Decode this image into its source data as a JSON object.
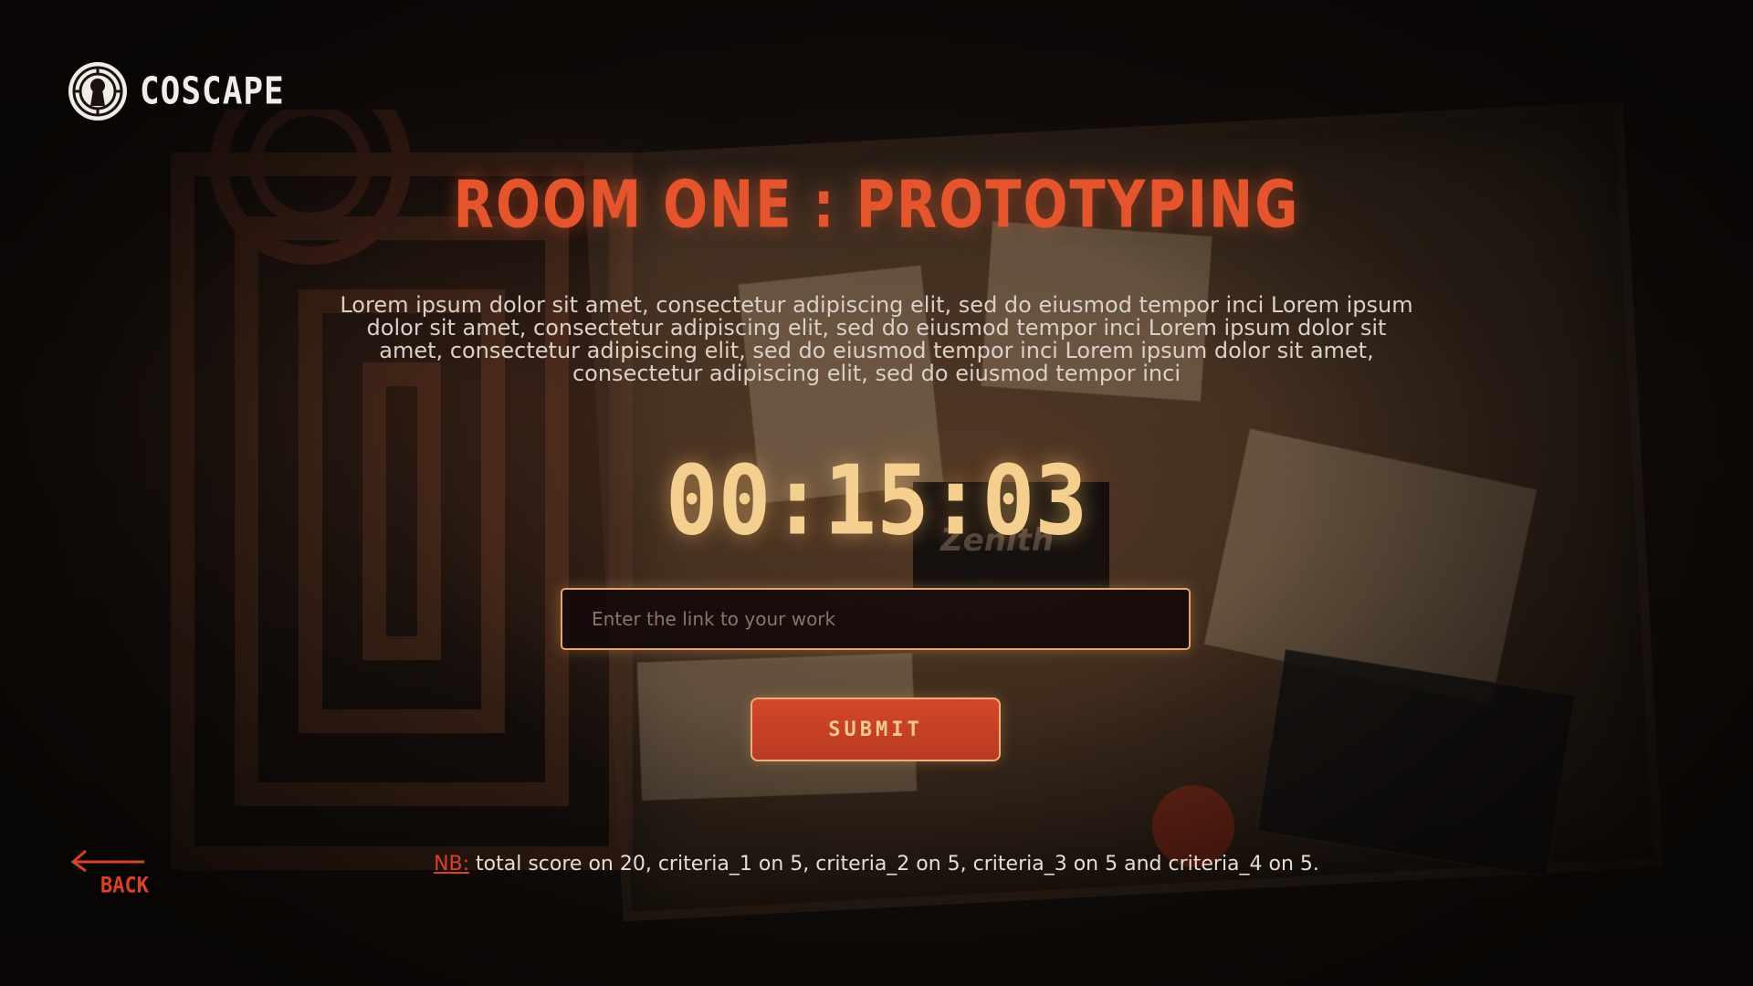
{
  "brand": {
    "name": "COSCAPE",
    "logo_icon": "keyhole-maze-icon"
  },
  "room": {
    "title": "ROOM ONE : PROTOTYPING",
    "description": "Lorem ipsum dolor sit amet, consectetur adipiscing elit, sed do eiusmod tempor inci Lorem ipsum dolor sit amet, consectetur adipiscing elit, sed do eiusmod tempor inci Lorem ipsum dolor sit amet, consectetur adipiscing elit, sed do eiusmod tempor inci Lorem ipsum dolor sit amet, consectetur adipiscing elit, sed do eiusmod tempor inci"
  },
  "timer": {
    "value": "00:15:03"
  },
  "form": {
    "link_placeholder": "Enter the link to your work",
    "link_value": "",
    "submit_label": "SUBMIT"
  },
  "navigation": {
    "back_label": "BACK",
    "back_icon": "arrow-left-icon"
  },
  "note": {
    "prefix": "NB:",
    "text": " total score on 20, criteria_1 on 5, criteria_2 on 5, criteria_3 on 5 and criteria_4 on 5."
  },
  "colors": {
    "accent_red": "#e4552d",
    "timer_gold": "#f4cf8f",
    "border_gold": "#e5a869",
    "button_red": "#c9402a",
    "background": "#110c0a"
  }
}
